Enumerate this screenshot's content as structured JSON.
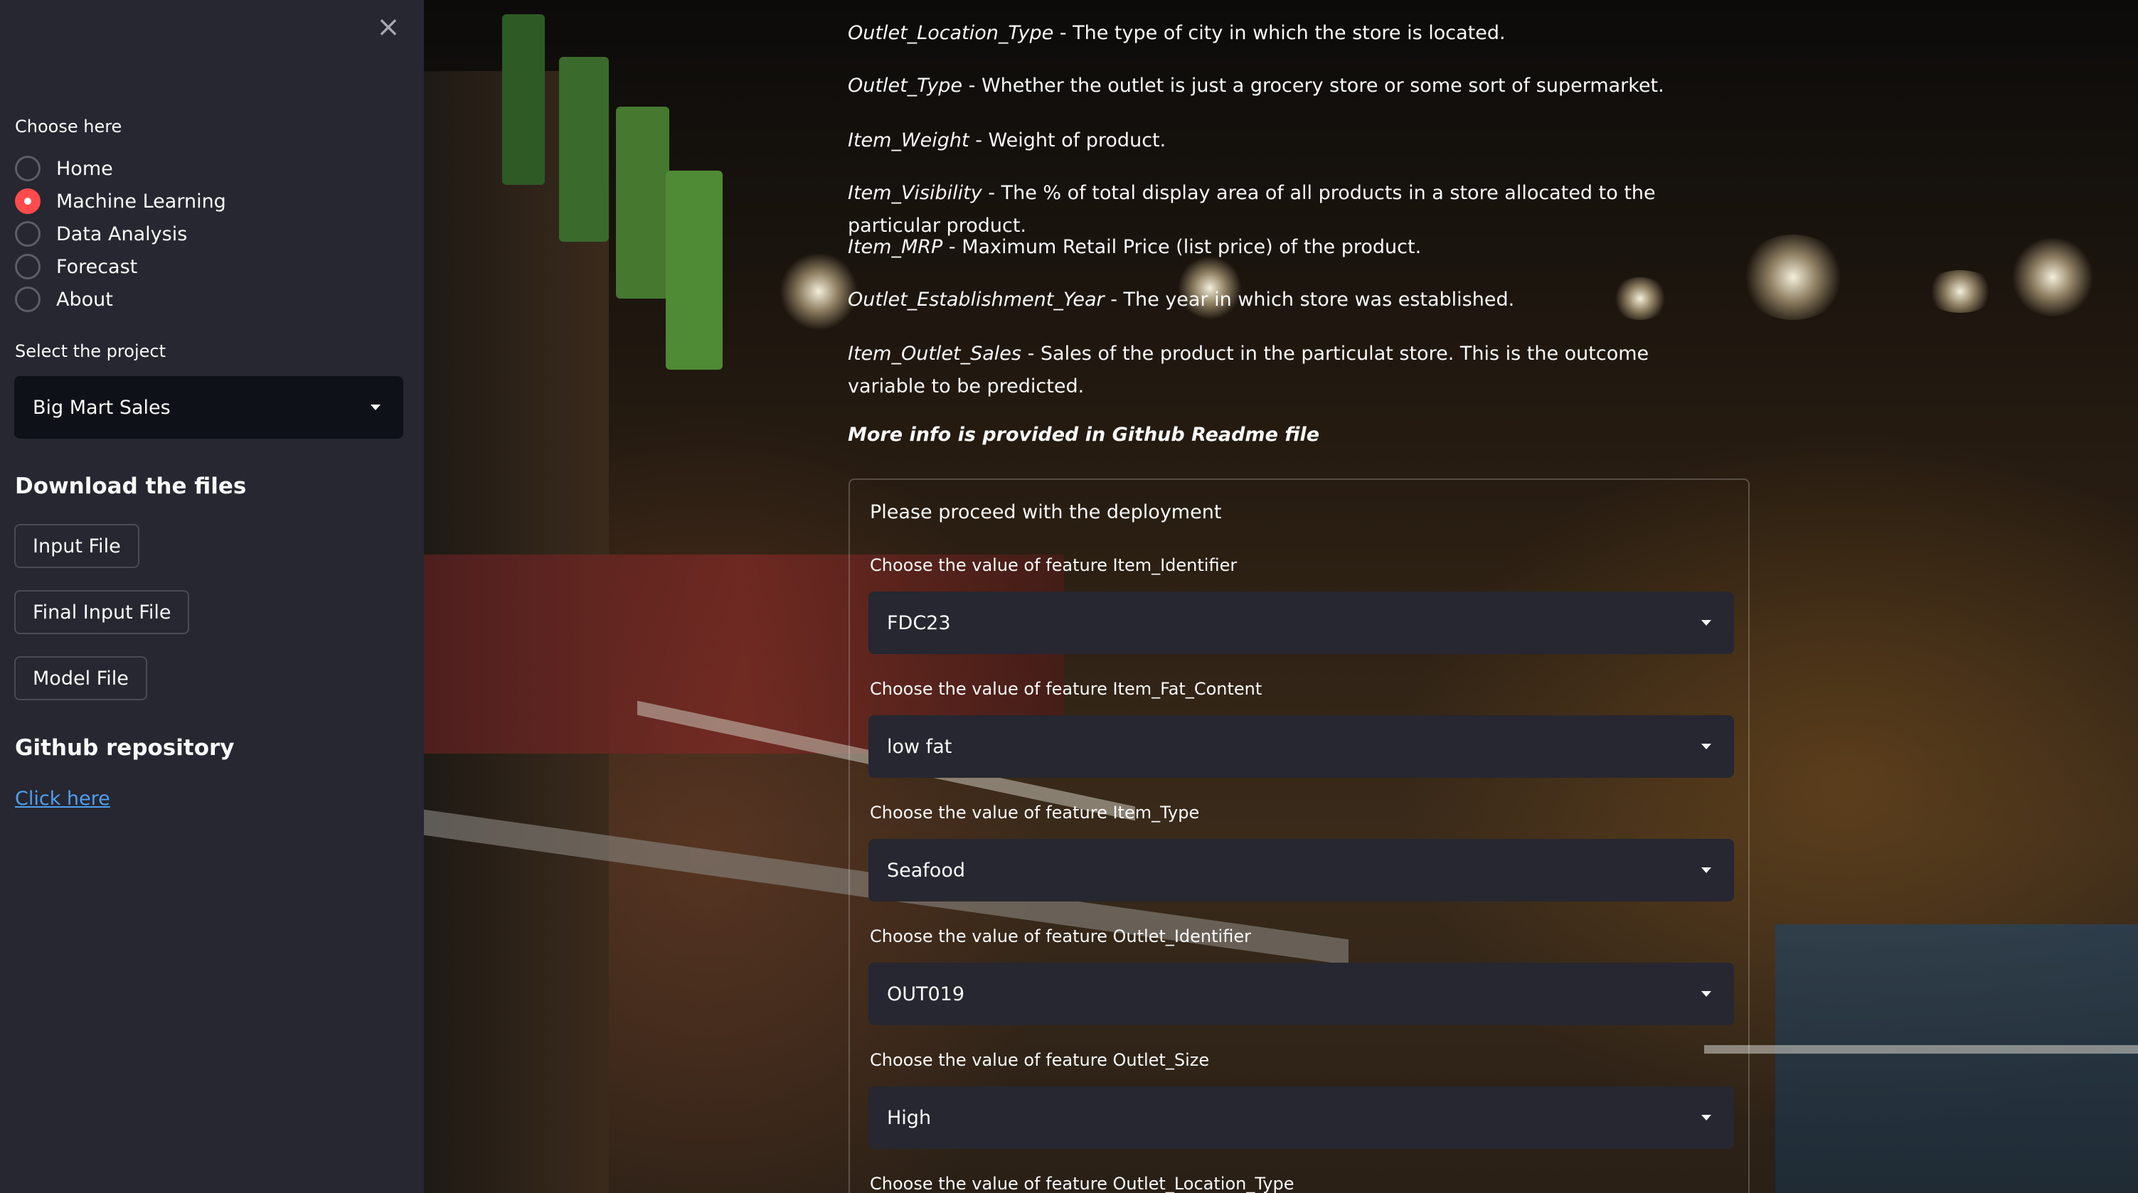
{
  "sidebar": {
    "close_label": "×",
    "nav_label": "Choose here",
    "nav_items": [
      {
        "label": "Home",
        "selected": false
      },
      {
        "label": "Machine Learning",
        "selected": true
      },
      {
        "label": "Data Analysis",
        "selected": false
      },
      {
        "label": "Forecast",
        "selected": false
      },
      {
        "label": "About",
        "selected": false
      }
    ],
    "project_label": "Select the project",
    "project_value": "Big Mart Sales",
    "download_heading": "Download the files",
    "buttons": [
      "Input File",
      "Final Input File",
      "Model File"
    ],
    "github_heading": "Github repository",
    "github_link": "Click here"
  },
  "main": {
    "descriptions": [
      {
        "term": "Outlet_Location_Type",
        "text": " - The type of city in which the store is located."
      },
      {
        "term": "Outlet_Type",
        "text": " - Whether the outlet is just a grocery store or some sort of supermarket."
      },
      {
        "term": "Item_Weight",
        "text": " - Weight of product."
      },
      {
        "term": "Item_Visibility",
        "text": " - The % of total display area of all products in a store allocated to the particular product."
      },
      {
        "term": "Item_MRP",
        "text": " - Maximum Retail Price (list price) of the product."
      },
      {
        "term": "Outlet_Establishment_Year",
        "text": " - The year in which store was established."
      },
      {
        "term": "Item_Outlet_Sales",
        "text": " - Sales of the product in the particulat store. This is the outcome variable to be predicted."
      }
    ],
    "more_info": "More info is provided in Github Readme file",
    "form": {
      "title": "Please proceed with the deployment",
      "fields": [
        {
          "label": "Choose the value of feature Item_Identifier",
          "value": "FDC23"
        },
        {
          "label": "Choose the value of feature Item_Fat_Content",
          "value": "low fat"
        },
        {
          "label": "Choose the value of feature Item_Type",
          "value": "Seafood"
        },
        {
          "label": "Choose the value of feature Outlet_Identifier",
          "value": "OUT019"
        },
        {
          "label": "Choose the value of feature Outlet_Size",
          "value": "High"
        },
        {
          "label": "Choose the value of feature Outlet_Location_Type",
          "value": ""
        }
      ]
    }
  },
  "colors": {
    "sidebar_bg": "#262730",
    "accent": "#ff4b4b",
    "link": "#4f9ff0",
    "select_bg": "#262730"
  }
}
